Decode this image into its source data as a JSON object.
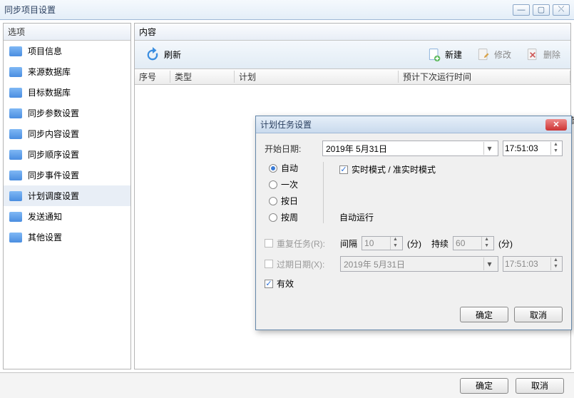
{
  "window": {
    "title": "同步项目设置"
  },
  "sidebar": {
    "header": "选项",
    "items": [
      {
        "label": "项目信息"
      },
      {
        "label": "来源数据库"
      },
      {
        "label": "目标数据库"
      },
      {
        "label": "同步参数设置"
      },
      {
        "label": "同步内容设置"
      },
      {
        "label": "同步顺序设置"
      },
      {
        "label": "同步事件设置"
      },
      {
        "label": "计划调度设置"
      },
      {
        "label": "发送通知"
      },
      {
        "label": "其他设置"
      }
    ]
  },
  "content": {
    "header": "内容",
    "toolbar": {
      "refresh": "刷新",
      "new": "新建",
      "edit": "修改",
      "delete": "删除"
    },
    "table": {
      "col1": "序号",
      "col2": "类型",
      "col3": "计划",
      "col4": "预计下次运行时间"
    }
  },
  "dialog": {
    "title": "计划任务设置",
    "start_date_label": "开始日期:",
    "start_date": "2019年 5月31日",
    "start_time": "17:51:03",
    "radios": {
      "auto": "自动",
      "once": "一次",
      "daily": "按日",
      "weekly": "按周"
    },
    "realtime_label": "实时模式 / 准实时模式",
    "auto_run": "自动运行",
    "repeat_label": "重复任务(R):",
    "interval_label": "间隔",
    "interval_value": "10",
    "interval_unit": "(分)",
    "duration_label": "持续",
    "duration_value": "60",
    "duration_unit": "(分)",
    "expire_label": "过期日期(X):",
    "expire_date": "2019年 5月31日",
    "expire_time": "17:51:03",
    "valid_label": "有效",
    "ok": "确定",
    "cancel": "取消"
  },
  "footer": {
    "ok": "确定",
    "cancel": "取消"
  },
  "side_word": "修"
}
